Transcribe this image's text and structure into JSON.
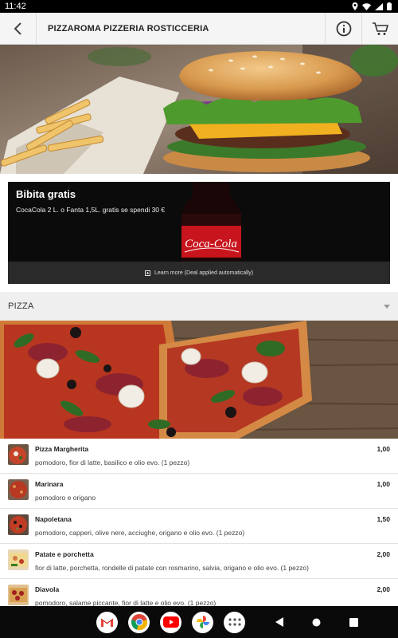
{
  "status_bar": {
    "time": "11:42"
  },
  "header": {
    "title": "PIZZAROMA PIZZERIA ROSTICCERIA"
  },
  "promo": {
    "title": "Bibita gratis",
    "text": "CocaCola 2 L. o Fanta 1,5L. gratis se spendi 30 €",
    "footer": "Learn more (Deal applied automatically)"
  },
  "category": {
    "name": "PIZZA"
  },
  "menu_items": [
    {
      "name": "Pizza Margherita",
      "description": "pomodoro, fior di latte, basilico e olio evo. (1 pezzo)",
      "price": "1,00"
    },
    {
      "name": "Marinara",
      "description": "pomodoro e origano",
      "price": "1,00"
    },
    {
      "name": "Napoletana",
      "description": "pomodoro, capperi, olive nere, acciughe, origano e olio evo. (1 pezzo)",
      "price": "1,50"
    },
    {
      "name": "Patate e porchetta",
      "description": "fior di latte, porchetta, rondelle di patate con rosmarino, salvia, origano e olio evo. (1 pezzo)",
      "price": "2,00"
    },
    {
      "name": "Diavola",
      "description": "pomodoro, salame piccante, fior di latte e olio evo. (1 pezzo)",
      "price": "2,00"
    }
  ],
  "nav_dock": [
    "gmail-icon",
    "chrome-icon",
    "youtube-icon",
    "photos-icon",
    "app-drawer-icon"
  ]
}
